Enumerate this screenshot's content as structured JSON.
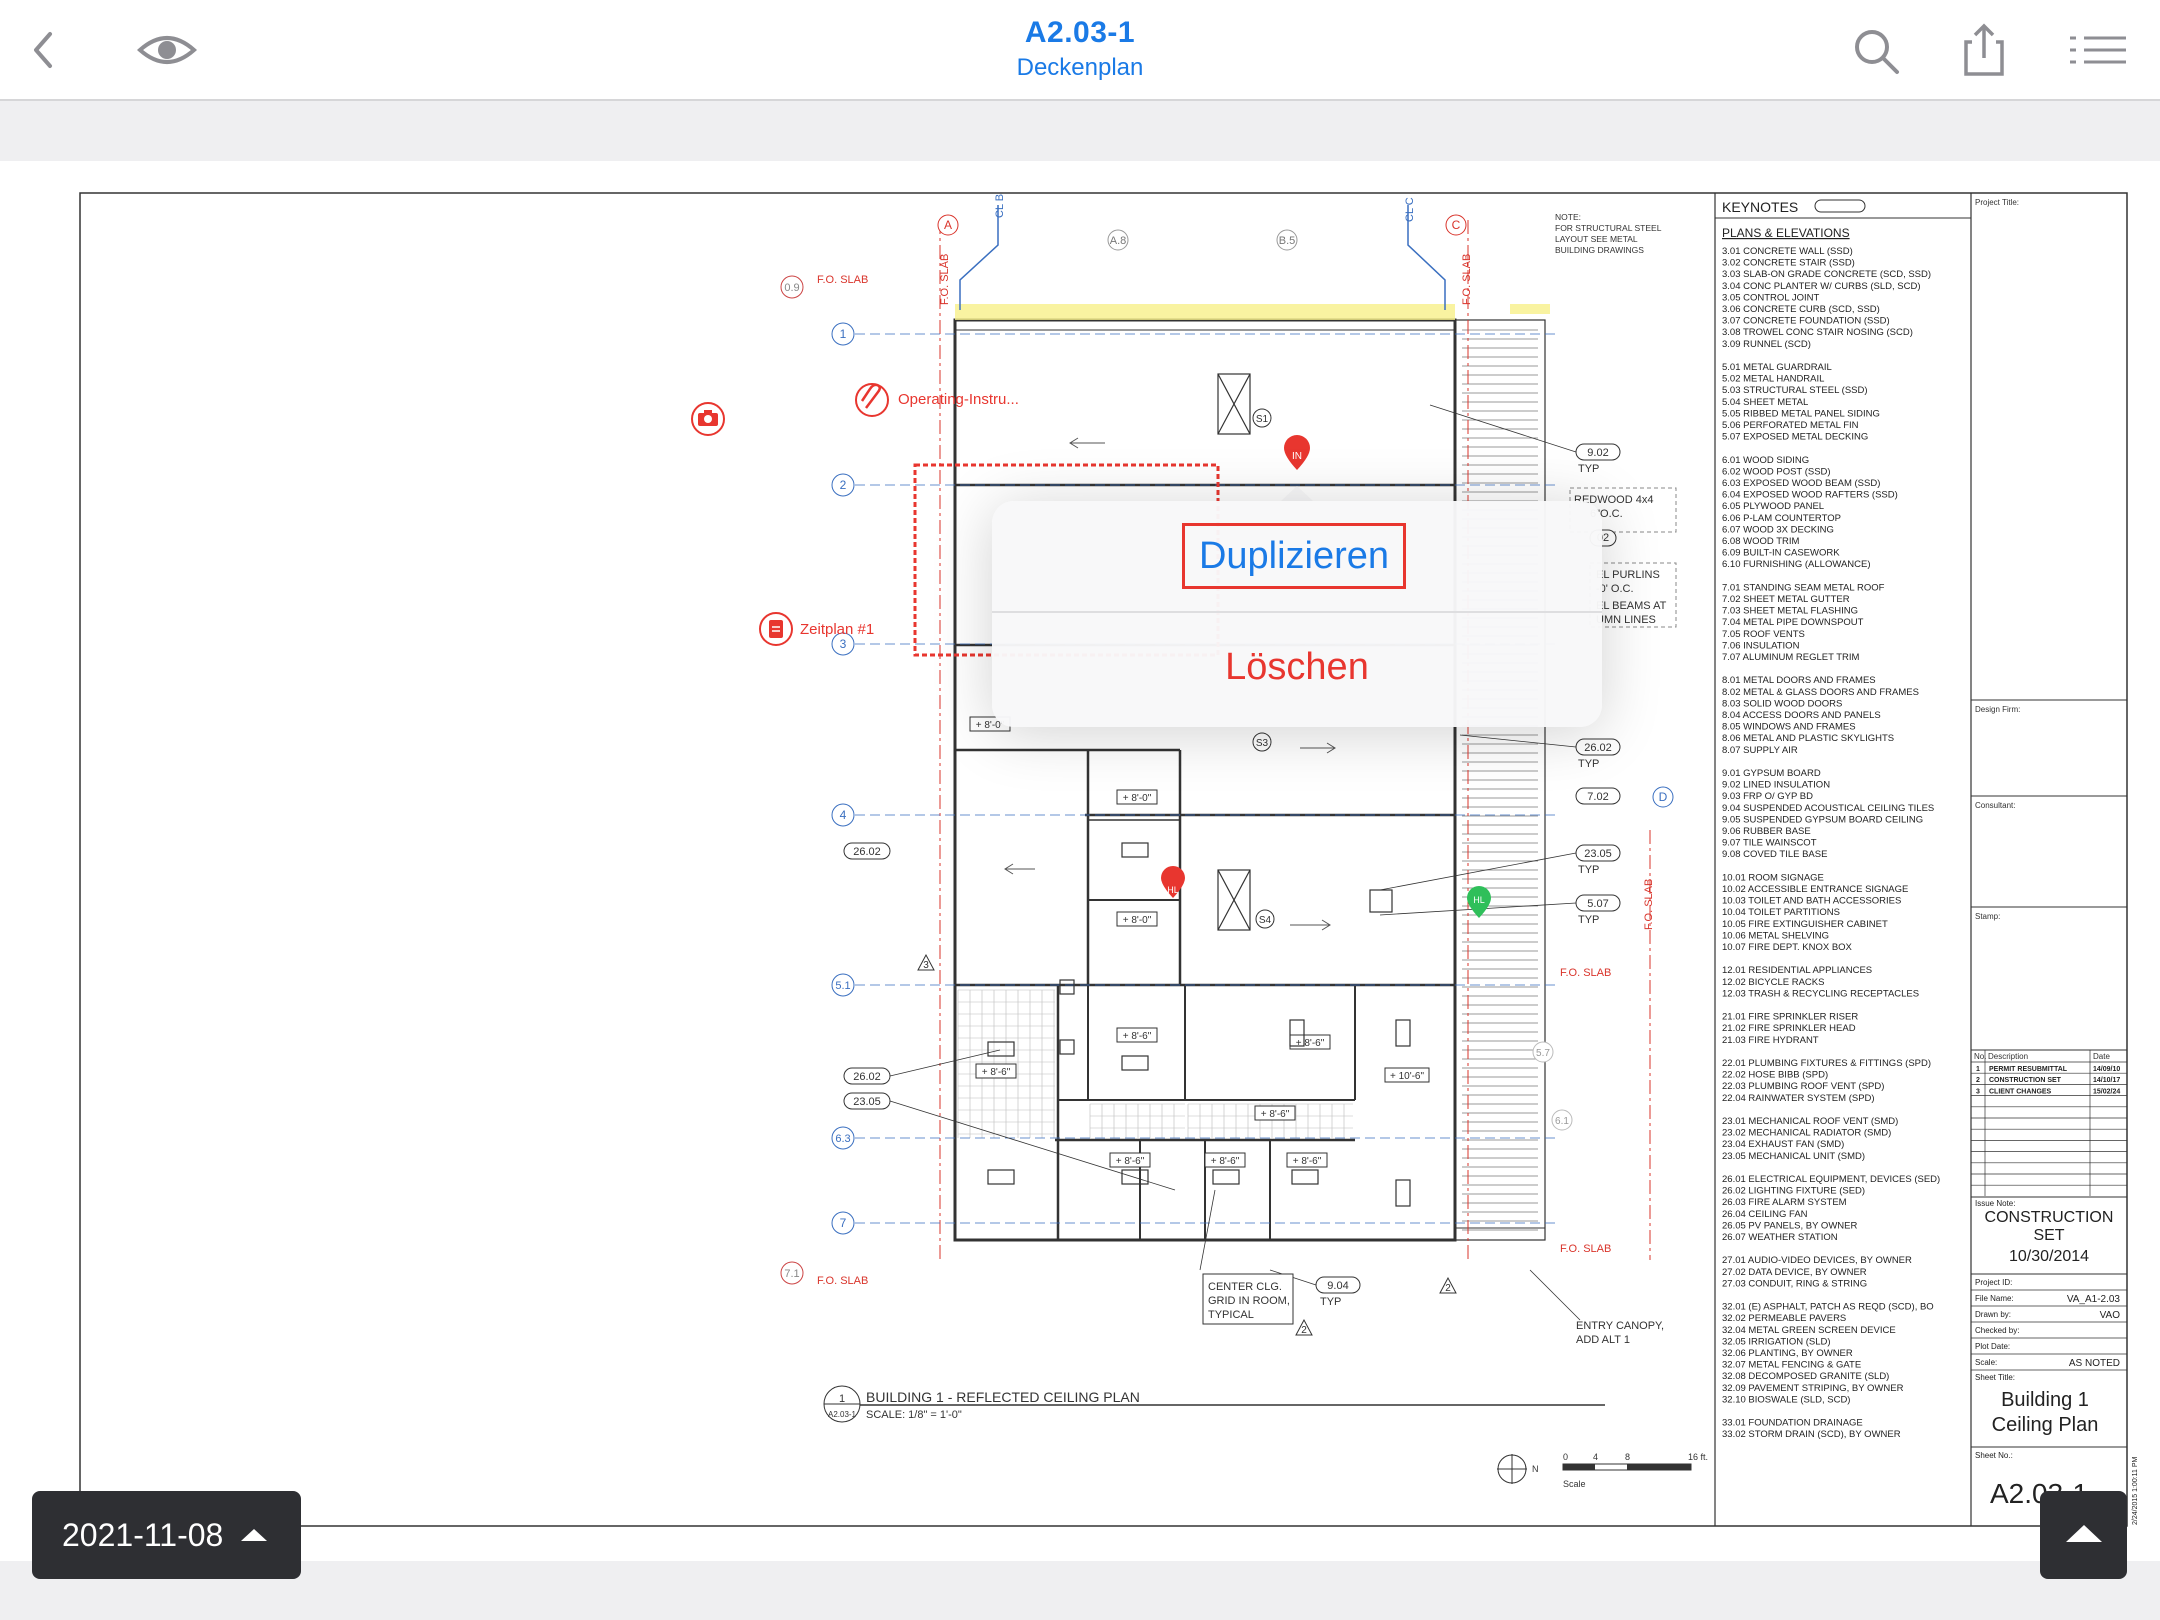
{
  "header": {
    "title": "A2.03-1",
    "subtitle": "Deckenplan",
    "back_icon": "chevron-left-icon",
    "view_icon": "eye-icon",
    "search_icon": "search-icon",
    "share_icon": "share-icon",
    "list_icon": "list-icon",
    "accent_color": "#1a7ae6"
  },
  "annotations": {
    "camera_icon": "camera-icon",
    "attachment_label": "Operating-Instru...",
    "schedule_label": "Zeitplan #1",
    "pin_in": "IN",
    "pin_hl_red": "HL",
    "pin_hl_green": "HL",
    "annotation_color": "#e8362f"
  },
  "context_menu": {
    "duplicate": "Duplizieren",
    "delete": "Löschen"
  },
  "drawing": {
    "grid_cols": [
      "A",
      "A.8",
      "B.5",
      "C",
      "D"
    ],
    "grid_rows": [
      "0.9",
      "1",
      "2",
      "3",
      "4",
      "5.1",
      "6.3",
      "7",
      "7.1",
      "5.7",
      "6.1"
    ],
    "cl_labels": [
      "CL B",
      "CL C"
    ],
    "fo_slab": "F.O. SLAB",
    "note": [
      "NOTE:",
      "FOR STRUCTURAL STEEL",
      "LAYOUT SEE METAL",
      "BUILDING DRAWINGS"
    ],
    "tags": [
      "9.02",
      "TYP",
      "REDWOOD 4x4",
      "6\"O.C.",
      "EL PURLINS",
      "-0' O.C.",
      "EL BEAMS AT",
      "UMN LINES",
      "26.02",
      "TYP",
      "7.02",
      "23.05",
      "TYP",
      "5.07",
      "TYP",
      "26.02",
      "26.02",
      "23.05",
      "9.04",
      "TYP"
    ],
    "heights": [
      "+ 8'-0\"",
      "+ 8'-0\"",
      "+ 8'-0\"",
      "+ 8'-6\"",
      "+ 8'-6\"",
      "+ 8'-6\"",
      "+ 10'-6\"",
      "+ 8'-6\"",
      "+ 8'-6\"",
      "+ 8'-6\"",
      "+ 8'-6\""
    ],
    "symbols": [
      "S1",
      "S3",
      "S4"
    ],
    "center_note": [
      "CENTER CLG.",
      "GRID IN ROOM,",
      "TYPICAL"
    ],
    "entry_note": [
      "ENTRY CANOPY,",
      "ADD ALT 1"
    ],
    "plan_number": "1",
    "plan_sheet": "A2.03-1",
    "plan_title": "BUILDING 1 - REFLECTED CEILING PLAN",
    "plan_scale": "SCALE: 1/8\" = 1'-0\"",
    "scale_ticks": [
      "0",
      "4",
      "8",
      "16 ft."
    ],
    "scale_label": "Scale",
    "north": "N"
  },
  "keynotes": {
    "title": "KEYNOTES",
    "subtitle": "PLANS & ELEVATIONS",
    "groups": [
      [
        "3.01 CONCRETE WALL (SSD)",
        "3.02 CONCRETE STAIR (SSD)",
        "3.03 SLAB-ON GRADE CONCRETE (SCD, SSD)",
        "3.04 CONC PLANTER W/ CURBS (SLD, SCD)",
        "3.05 CONTROL JOINT",
        "3.06 CONCRETE CURB (SCD, SSD)",
        "3.07 CONCRETE FOUNDATION (SSD)",
        "3.08 TROWEL CONC STAIR NOSING (SCD)",
        "3.09 RUNNEL (SCD)"
      ],
      [
        "5.01 METAL GUARDRAIL",
        "5.02 METAL HANDRAIL",
        "5.03 STRUCTURAL STEEL (SSD)",
        "5.04 SHEET METAL",
        "5.05 RIBBED METAL PANEL SIDING",
        "5.06 PERFORATED METAL FIN",
        "5.07 EXPOSED METAL DECKING"
      ],
      [
        "6.01 WOOD SIDING",
        "6.02 WOOD POST (SSD)",
        "6.03 EXPOSED WOOD BEAM (SSD)",
        "6.04 EXPOSED WOOD RAFTERS (SSD)",
        "6.05 PLYWOOD PANEL",
        "6.06 P-LAM COUNTERTOP",
        "6.07 WOOD 3X DECKING",
        "6.08 WOOD TRIM",
        "6.09 BUILT-IN CASEWORK",
        "6.10 FURNISHING (ALLOWANCE)"
      ],
      [
        "7.01 STANDING SEAM METAL ROOF",
        "7.02 SHEET METAL GUTTER",
        "7.03 SHEET METAL FLASHING",
        "7.04 METAL PIPE DOWNSPOUT",
        "7.05 ROOF VENTS",
        "7.06 INSULATION",
        "7.07 ALUMINUM REGLET TRIM"
      ],
      [
        "8.01 METAL DOORS AND FRAMES",
        "8.02 METAL & GLASS DOORS AND FRAMES",
        "8.03 SOLID WOOD DOORS",
        "8.04 ACCESS DOORS AND PANELS",
        "8.05 WINDOWS AND FRAMES",
        "8.06 METAL AND PLASTIC SKYLIGHTS",
        "8.07 SUPPLY AIR"
      ],
      [
        "9.01 GYPSUM BOARD",
        "9.02 LINED INSULATION",
        "9.03 FRP O/ GYP BD",
        "9.04 SUSPENDED ACOUSTICAL CEILING TILES",
        "9.05 SUSPENDED GYPSUM BOARD CEILING",
        "9.06 RUBBER BASE",
        "9.07 TILE WAINSCOT",
        "9.08 COVED TILE BASE"
      ],
      [
        "10.01 ROOM SIGNAGE",
        "10.02 ACCESSIBLE ENTRANCE SIGNAGE",
        "10.03 TOILET AND BATH ACCESSORIES",
        "10.04 TOILET PARTITIONS",
        "10.05 FIRE EXTINGUISHER CABINET",
        "10.06 METAL SHELVING",
        "10.07 FIRE DEPT. KNOX BOX"
      ],
      [
        "12.01 RESIDENTIAL APPLIANCES",
        "12.02 BICYCLE RACKS",
        "12.03 TRASH & RECYCLING RECEPTACLES"
      ],
      [
        "21.01 FIRE SPRINKLER RISER",
        "21.02 FIRE SPRINKLER HEAD",
        "21.03 FIRE HYDRANT"
      ],
      [
        "22.01 PLUMBING FIXTURES & FITTINGS (SPD)",
        "22.02 HOSE BIBB (SPD)",
        "22.03 PLUMBING ROOF VENT (SPD)",
        "22.04 RAINWATER SYSTEM (SPD)"
      ],
      [
        "23.01 MECHANICAL ROOF VENT (SMD)",
        "23.02 MECHANICAL RADIATOR (SMD)",
        "23.04 EXHAUST FAN (SMD)",
        "23.05 MECHANICAL UNIT (SMD)"
      ],
      [
        "26.01 ELECTRICAL EQUIPMENT, DEVICES (SED)",
        "26.02 LIGHTING FIXTURE (SED)",
        "26.03 FIRE ALARM SYSTEM",
        "26.04 CEILING FAN",
        "26.05 PV PANELS, BY OWNER",
        "26.07 WEATHER STATION"
      ],
      [
        "27.01 AUDIO-VIDEO DEVICES, BY OWNER",
        "27.02 DATA DEVICE, BY OWNER",
        "27.03 CONDUIT, RING & STRING"
      ],
      [
        "32.01 (E) ASPHALT, PATCH AS REQD (SCD), BO",
        "32.02 PERMEABLE PAVERS",
        "32.04 METAL GREEN SCREEN DEVICE",
        "32.05 IRRIGATION (SLD)",
        "32.06 PLANTING, BY OWNER",
        "32.07 METAL FENCING & GATE",
        "32.08 DECOMPOSED GRANITE (SLD)",
        "32.09 PAVEMENT STRIPING, BY OWNER",
        "32.10 BIOSWALE (SLD, SCD)"
      ],
      [
        "33.01 FOUNDATION DRAINAGE",
        "33.02 STORM DRAIN (SCD), BY OWNER"
      ]
    ]
  },
  "title_block": {
    "project_title": "Project Title:",
    "design_firm": "Design Firm:",
    "consultant": "Consultant:",
    "stamp": "Stamp:",
    "rev_headers": [
      "No.",
      "Description",
      "Date"
    ],
    "revisions": [
      [
        "1",
        "PERMIT RESUBMITTAL",
        "14/09/10"
      ],
      [
        "2",
        "CONSTRUCTION SET",
        "14/10/17"
      ],
      [
        "3",
        "CLIENT CHANGES",
        "15/02/24"
      ]
    ],
    "issue_note_label": "Issue Note:",
    "issue_line1": "CONSTRUCTION",
    "issue_line2": "SET",
    "issue_date": "10/30/2014",
    "fields": [
      [
        "Project ID:",
        ""
      ],
      [
        "File Name:",
        "VA_A1-2.03"
      ],
      [
        "Drawn by:",
        "VAO"
      ],
      [
        "Checked by:",
        ""
      ],
      [
        "Plot Date:",
        ""
      ],
      [
        "Scale:",
        "AS NOTED"
      ]
    ],
    "sheet_title_label": "Sheet Title:",
    "sheet_title_1": "Building 1",
    "sheet_title_2": "Ceiling Plan",
    "sheet_no_label": "Sheet No.:",
    "sheet_no": "A2.03-1",
    "plot_stamp": "2/24/2015 1:00:11 PM"
  },
  "footer": {
    "date_label": "2021-11-08",
    "date_caret_icon": "caret-up-icon",
    "up_button_icon": "caret-up-icon"
  }
}
